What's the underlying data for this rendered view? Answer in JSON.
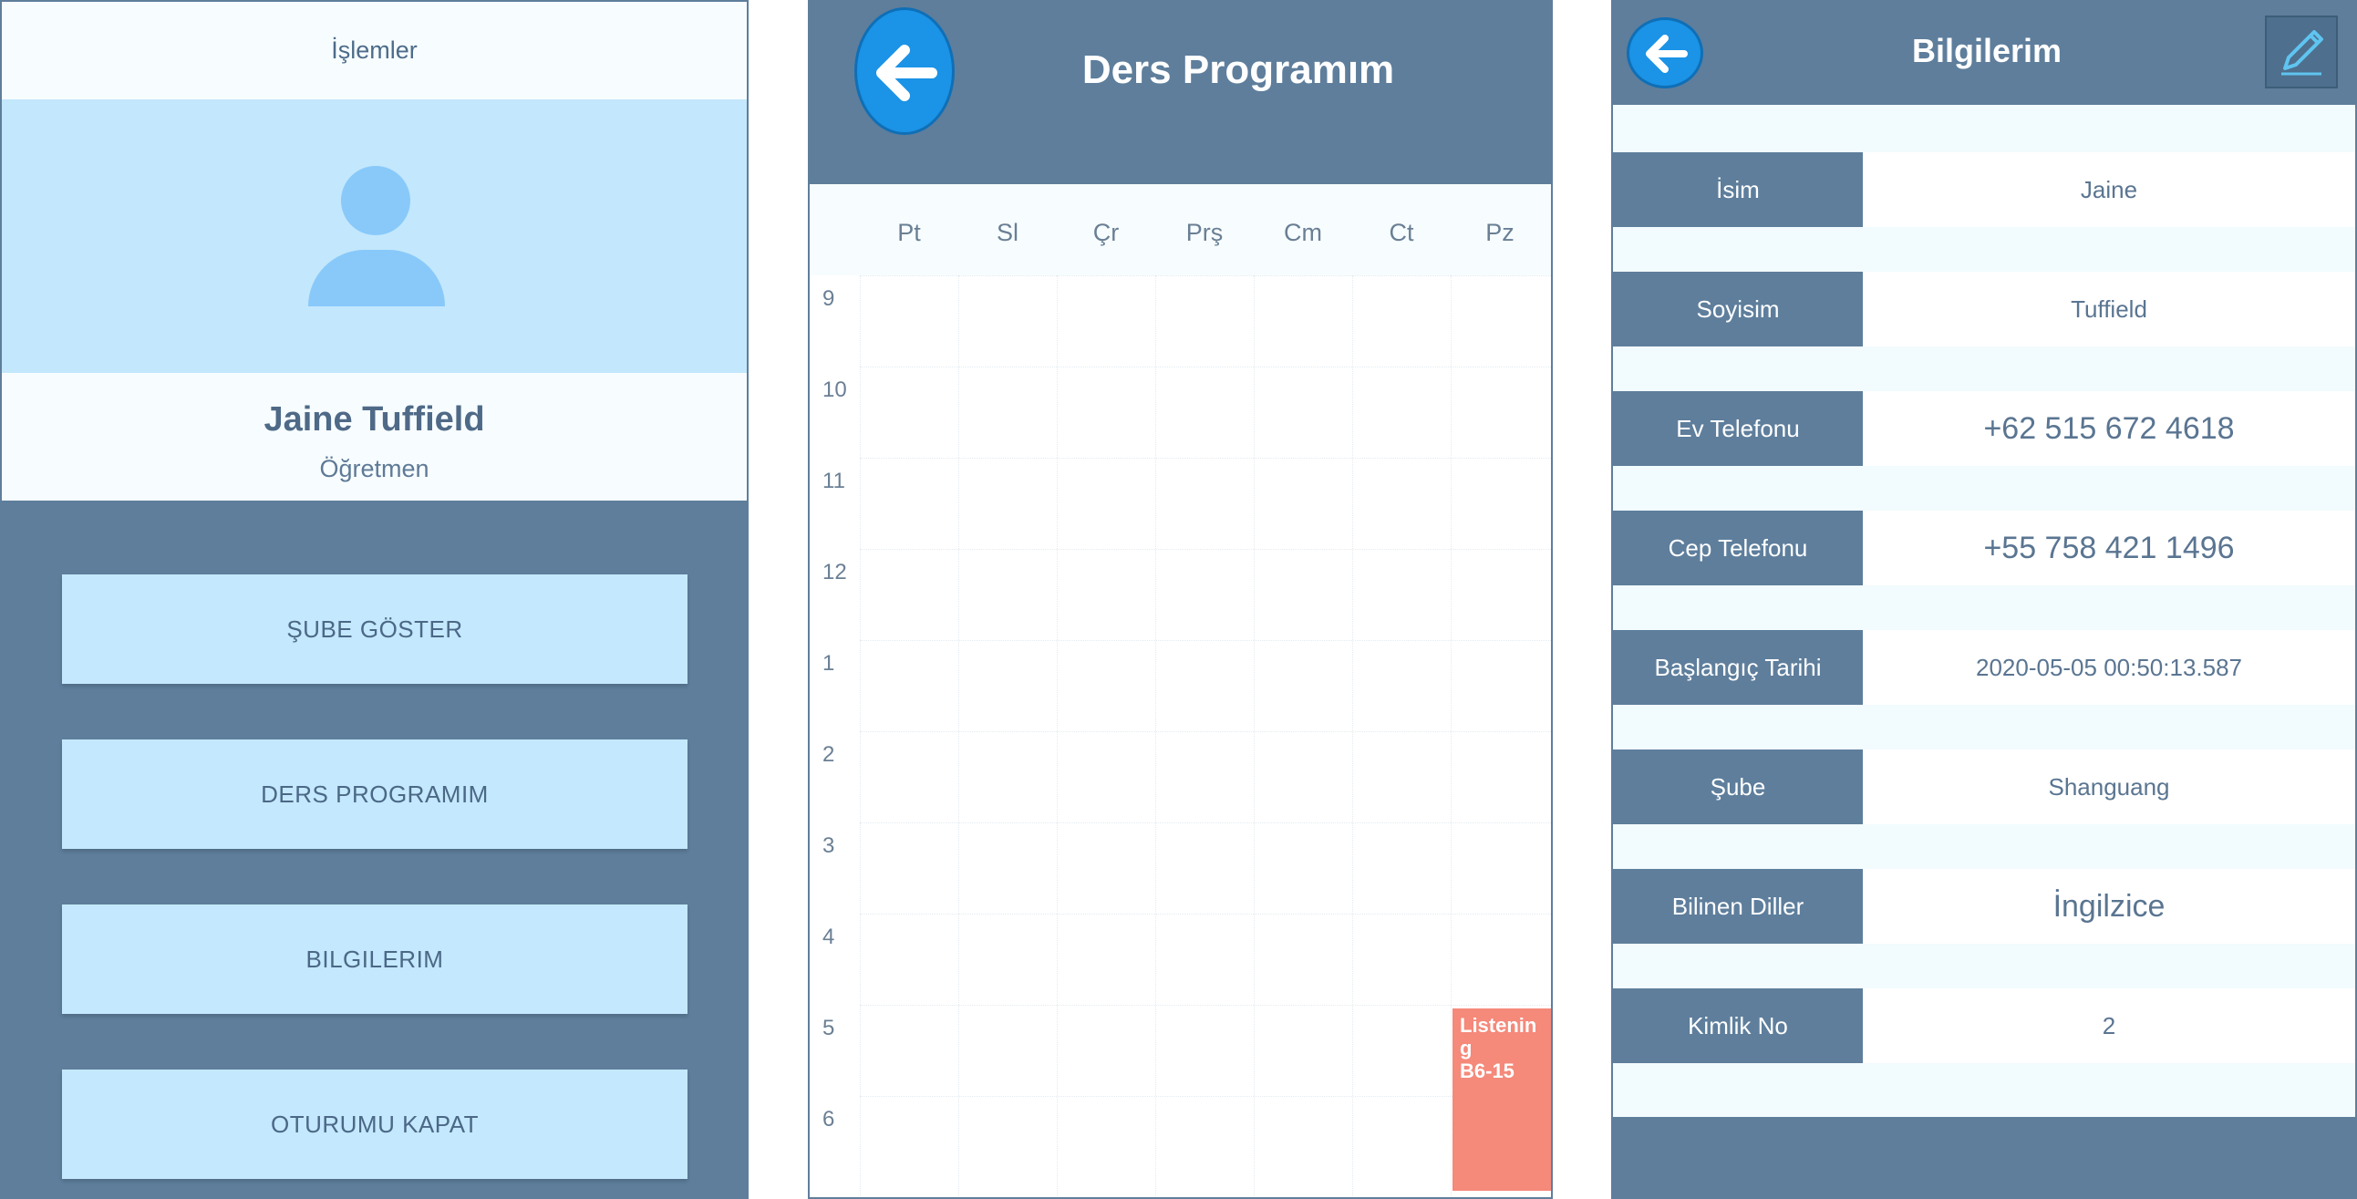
{
  "menu_screen": {
    "header_title": "İşlemler",
    "user_name": "Jaine Tuffield",
    "user_role": "Öğretmen",
    "buttons": [
      {
        "label": "ŞUBE GÖSTER"
      },
      {
        "label": "DERS PROGRAMIM"
      },
      {
        "label": "BILGILERIM"
      },
      {
        "label": "OTURUMU KAPAT"
      }
    ],
    "icons": {
      "avatar": "person-avatar-icon"
    }
  },
  "schedule_screen": {
    "title": "Ders Programım",
    "days": [
      "Pt",
      "Sl",
      "Çr",
      "Prş",
      "Cm",
      "Ct",
      "Pz"
    ],
    "hours": [
      "9",
      "10",
      "11",
      "12",
      "1",
      "2",
      "3",
      "4",
      "5",
      "6"
    ],
    "event": {
      "name": "Listenin\ng",
      "room": "B6-15",
      "day": "Pz",
      "start_hour": "5",
      "color": "#f5897a"
    },
    "icons": {
      "back": "back-arrow-icon"
    }
  },
  "info_screen": {
    "title": "Bilgilerim",
    "fields": [
      {
        "label": "İsim",
        "value": "Jaine"
      },
      {
        "label": "Soyisim",
        "value": "Tuffield"
      },
      {
        "label": "Ev Telefonu",
        "value": "+62 515 672 4618"
      },
      {
        "label": "Cep Telefonu",
        "value": "+55 758 421 1496"
      },
      {
        "label": "Başlangıç Tarihi",
        "value": "2020-05-05 00:50:13.587"
      },
      {
        "label": "Şube",
        "value": "Shanguang"
      },
      {
        "label": "Bilinen Diller",
        "value": "İngilzice"
      },
      {
        "label": "Kimlik No",
        "value": "2"
      }
    ],
    "icons": {
      "back": "back-arrow-icon",
      "edit": "pencil-edit-icon"
    }
  },
  "colors": {
    "header_blue": "#5e7e9c",
    "light_blue": "#c4e8fd",
    "back_button_blue": "#1b93e6",
    "event_salmon": "#f5897a"
  }
}
